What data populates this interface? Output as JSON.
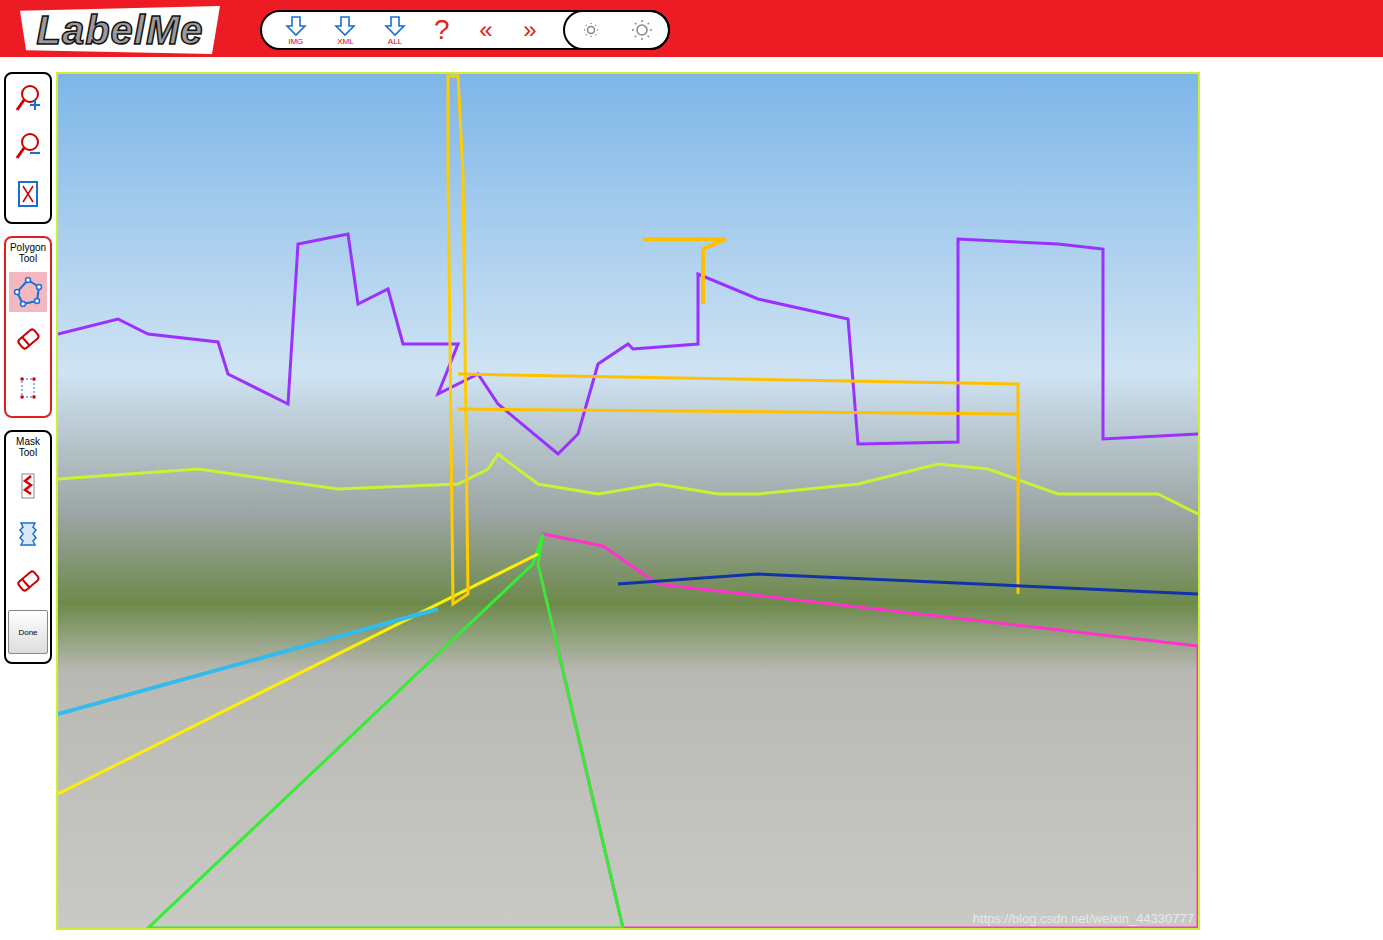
{
  "header": {
    "logo": "LabelMe",
    "toolbar": [
      {
        "label": "IMG",
        "kind": "download"
      },
      {
        "label": "XML",
        "kind": "download"
      },
      {
        "label": "ALL",
        "kind": "download"
      },
      {
        "label": "?",
        "kind": "glyph"
      },
      {
        "label": "«",
        "kind": "glyph"
      },
      {
        "label": "»",
        "kind": "glyph"
      }
    ],
    "brightness": [
      {
        "kind": "darker"
      },
      {
        "kind": "brighter"
      }
    ]
  },
  "sidebar": {
    "panels": [
      {
        "title": null,
        "accent": false,
        "tools": [
          {
            "kind": "zoom-in",
            "selected": false
          },
          {
            "kind": "zoom-out",
            "selected": false
          },
          {
            "kind": "fit",
            "selected": false
          }
        ],
        "button": null
      },
      {
        "title": "Polygon Tool",
        "accent": true,
        "tools": [
          {
            "kind": "polygon",
            "selected": true
          },
          {
            "kind": "eraser",
            "selected": false
          },
          {
            "kind": "bbox",
            "selected": false
          }
        ],
        "button": null
      },
      {
        "title": "Mask Tool",
        "accent": false,
        "tools": [
          {
            "kind": "brush",
            "selected": false
          },
          {
            "kind": "mask",
            "selected": false
          },
          {
            "kind": "eraser",
            "selected": false
          }
        ],
        "button": "Done"
      }
    ]
  },
  "image": {
    "watermark": "https://blog.csdn.net/weixin_44330777"
  }
}
